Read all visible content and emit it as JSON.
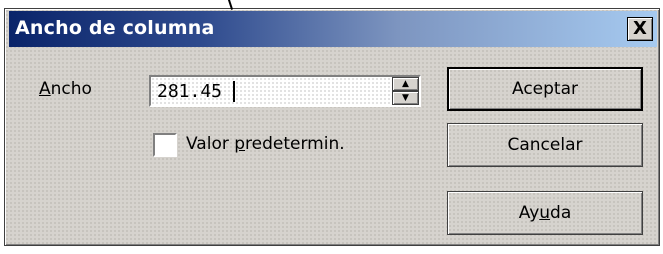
{
  "dialog": {
    "title": "Ancho de columna",
    "close_glyph": "X"
  },
  "width": {
    "label_hotkey": "A",
    "label_rest": "ncho",
    "value": "281.45",
    "spin_up": "▲",
    "spin_down": "▼"
  },
  "default_option": {
    "label_pre": "Valor ",
    "label_hotkey": "p",
    "label_post": "redetermin.",
    "checked": false
  },
  "buttons": {
    "ok": "Aceptar",
    "cancel": "Cancelar",
    "help_pre": "Ay",
    "help_hotkey": "u",
    "help_post": "da"
  }
}
